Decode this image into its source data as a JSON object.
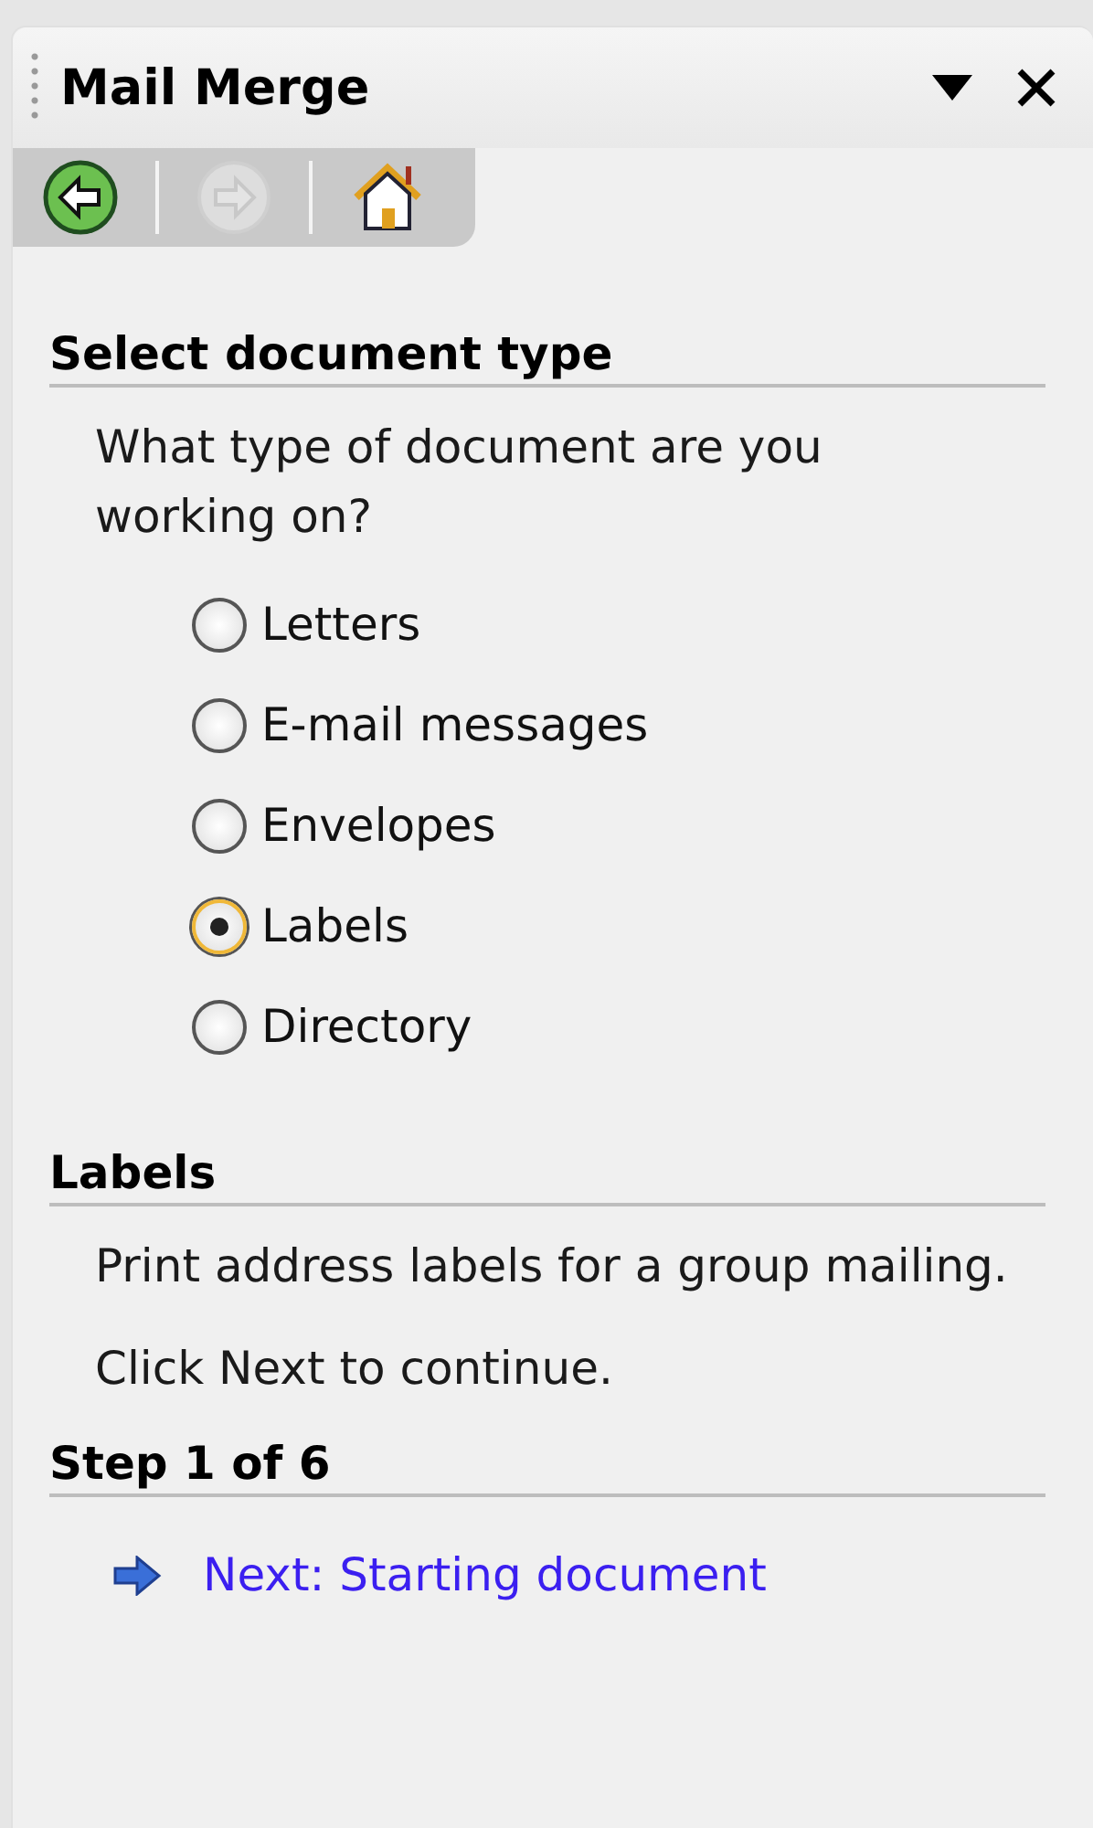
{
  "pane": {
    "title": "Mail Merge"
  },
  "toolbar": [
    {
      "kind": "back",
      "disabled": false
    },
    {
      "kind": "forward",
      "disabled": true
    },
    {
      "kind": "home",
      "disabled": false
    }
  ],
  "sections": [
    {
      "heading": "Select document type",
      "paragraphs": [
        "What type of document are you working on?"
      ],
      "options": [
        {
          "label": "Letters",
          "selected": false
        },
        {
          "label": "E-mail messages",
          "selected": false
        },
        {
          "label": "Envelopes",
          "selected": false
        },
        {
          "label": "Labels",
          "selected": true
        },
        {
          "label": "Directory",
          "selected": false
        }
      ]
    },
    {
      "heading": "Labels",
      "paragraphs": [
        "Print address labels for a group mailing.",
        "Click Next to continue."
      ]
    },
    {
      "heading": "Step 1 of 6",
      "links": [
        "Next: Starting document"
      ]
    }
  ]
}
